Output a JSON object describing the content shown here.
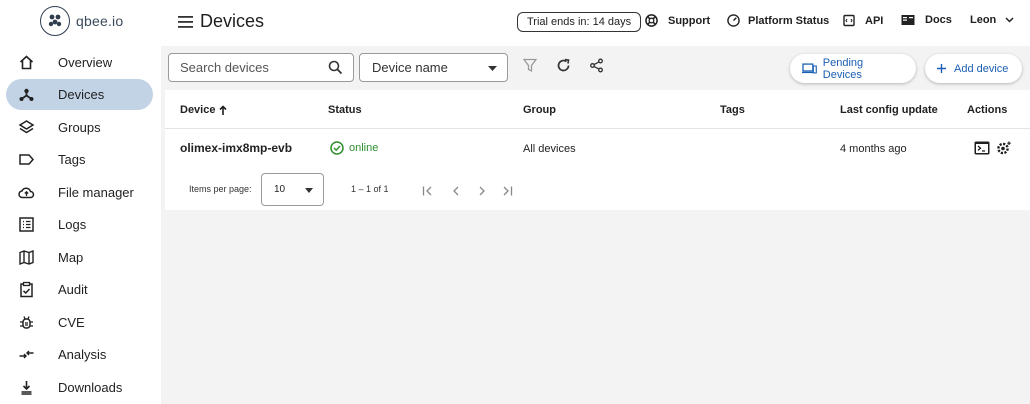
{
  "brand": {
    "logo_text": "qbee.io"
  },
  "header": {
    "title": "Devices",
    "trial": "Trial ends in: 14 days",
    "support": "Support",
    "platform_status": "Platform Status",
    "api": "API",
    "docs": "Docs",
    "user": "Leon"
  },
  "sidebar": {
    "items": [
      {
        "label": "Overview",
        "icon": "home-icon"
      },
      {
        "label": "Devices",
        "icon": "devices-icon",
        "active": true
      },
      {
        "label": "Groups",
        "icon": "layers-icon"
      },
      {
        "label": "Tags",
        "icon": "tag-icon"
      },
      {
        "label": "File manager",
        "icon": "cloud-upload-icon"
      },
      {
        "label": "Logs",
        "icon": "list-icon"
      },
      {
        "label": "Map",
        "icon": "map-icon"
      },
      {
        "label": "Audit",
        "icon": "clipboard-check-icon"
      },
      {
        "label": "CVE",
        "icon": "bug-icon"
      },
      {
        "label": "Analysis",
        "icon": "compare-arrows-icon"
      },
      {
        "label": "Downloads",
        "icon": "download-icon"
      }
    ]
  },
  "toolbar": {
    "search_placeholder": "Search devices",
    "filter_field": "Device name",
    "pending_devices": "Pending Devices",
    "add_device": "Add device"
  },
  "table": {
    "columns": [
      "Device",
      "Status",
      "Group",
      "Tags",
      "Last config update",
      "Actions"
    ],
    "rows": [
      {
        "device": "olimex-imx8mp-evb",
        "status": "online",
        "group": "All devices",
        "tags": "",
        "last_update": "4 months ago"
      }
    ]
  },
  "pagination": {
    "label": "Items per page:",
    "per_page": "10",
    "range": "1 – 1 of 1"
  },
  "colors": {
    "accent": "#1a5fb4",
    "active_nav": "#c3d3e6",
    "online": "#2f8f2f",
    "content_bg": "#f3f3f3"
  }
}
